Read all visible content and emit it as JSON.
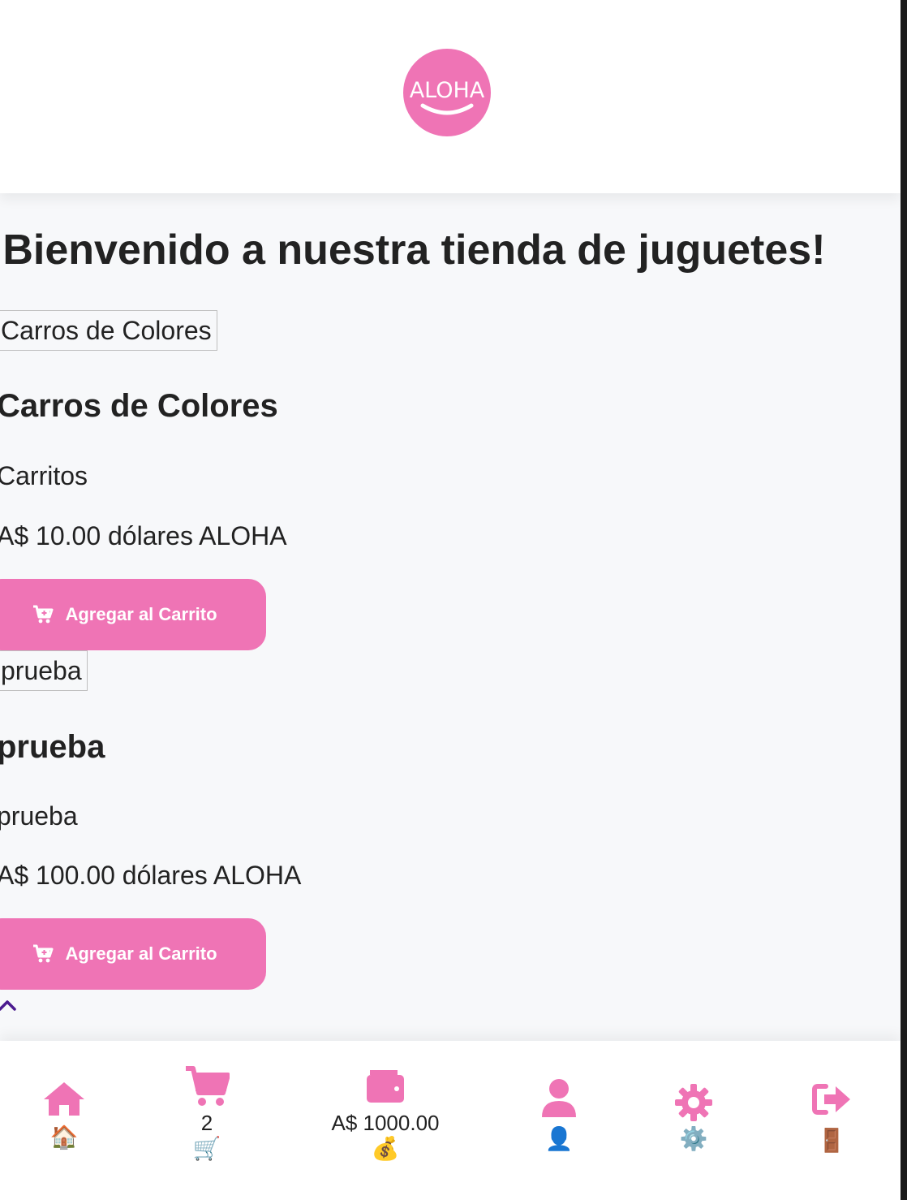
{
  "header": {
    "logo_text": "ALOHA"
  },
  "main": {
    "welcome": "¡Bienvenido a nuestra tienda de juguetes!",
    "products": [
      {
        "image_alt": "Carros de Colores",
        "title": "Carros de Colores",
        "description": "Carritos",
        "price": "A$ 10.00 dólares ALOHA",
        "button_label": "Agregar al Carrito"
      },
      {
        "image_alt": "prueba",
        "title": "prueba",
        "description": "prueba",
        "price": "A$ 100.00 dólares ALOHA",
        "button_label": "Agregar al Carrito"
      }
    ]
  },
  "bottom_nav": {
    "home": {
      "icon": "home-icon",
      "emoji": "🏠"
    },
    "cart": {
      "icon": "cart-icon",
      "count": "2",
      "emoji": "🛒"
    },
    "wallet": {
      "icon": "wallet-icon",
      "balance": "A$ 1000.00",
      "emoji": "💰"
    },
    "profile": {
      "icon": "user-icon",
      "emoji": "👤"
    },
    "settings": {
      "icon": "gear-icon",
      "emoji": "⚙️"
    },
    "logout": {
      "icon": "sign-out-icon",
      "emoji": "🚪"
    }
  },
  "colors": {
    "accent": "#ef74b5",
    "background": "#f7f8fa",
    "text": "#222222",
    "chevron": "#4b1a8f"
  }
}
